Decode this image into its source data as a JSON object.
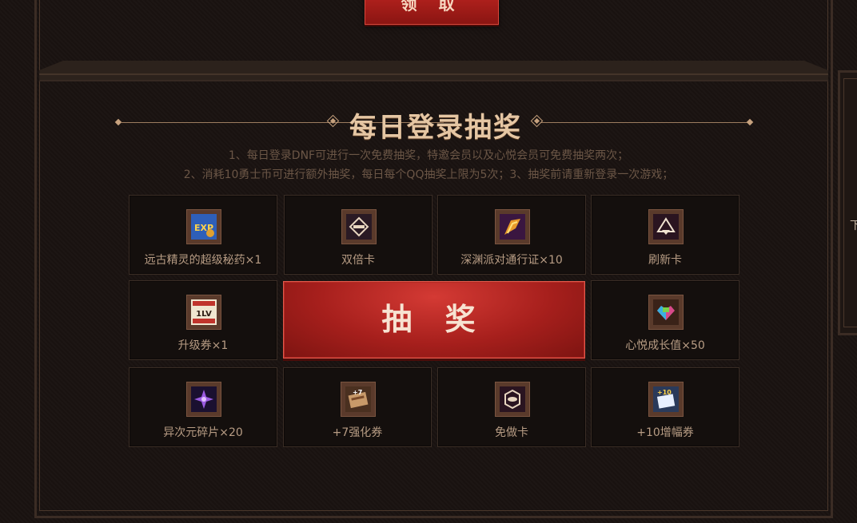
{
  "top": {
    "claim_label": "领 取"
  },
  "right_panel": {
    "text": "下"
  },
  "section": {
    "title": "每日登录抽奖",
    "rules": [
      "1、每日登录DNF可进行一次免费抽奖，特邀会员以及心悦会员可免费抽奖两次；",
      "2、消耗10勇士币可进行额外抽奖，每日每个QQ抽奖上限为5次；3、抽奖前请重新登录一次游戏；"
    ]
  },
  "draw": {
    "label": "抽 奖"
  },
  "prizes": [
    {
      "name": "远古精灵的超级秘药×1",
      "icon": "exp-potion-icon"
    },
    {
      "name": "双倍卡",
      "icon": "double-card-icon"
    },
    {
      "name": "深渊派对通行证×10",
      "icon": "abyss-pass-icon"
    },
    {
      "name": "刷新卡",
      "icon": "refresh-card-icon"
    },
    {
      "name": "升级券×1",
      "icon": "level-up-coupon-icon"
    },
    {
      "name": "心悦成长值×50",
      "icon": "growth-value-icon"
    },
    {
      "name": "异次元碎片×20",
      "icon": "dimension-shard-icon"
    },
    {
      "name": "+7强化券",
      "icon": "enhance-coupon-icon"
    },
    {
      "name": "免做卡",
      "icon": "skip-card-icon"
    },
    {
      "name": "+10增幅券",
      "icon": "amplify-coupon-icon"
    }
  ],
  "colors": {
    "background": "#1a1311",
    "accent_red": "#b8231f",
    "title_gold": "#e5c6a3",
    "text_muted": "#6b5646",
    "prize_text": "#b79c84"
  }
}
